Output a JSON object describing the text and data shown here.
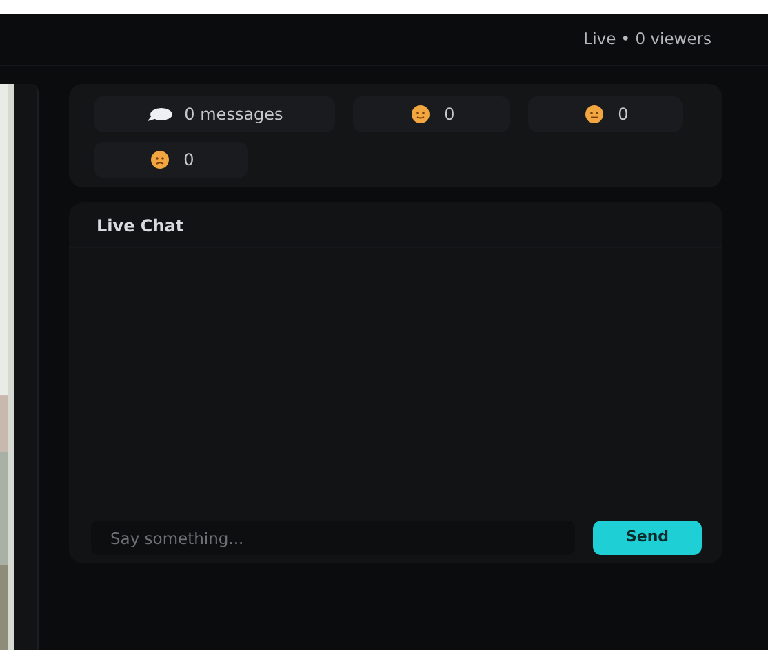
{
  "header": {
    "status": "Live • 0 viewers"
  },
  "stats": [
    {
      "kind": "chat",
      "text": "0 messages"
    },
    {
      "kind": "smile",
      "text": "0"
    },
    {
      "kind": "neutral",
      "text": "0"
    },
    {
      "kind": "sad",
      "text": "0"
    }
  ],
  "chat": {
    "title": "Live Chat",
    "input": {
      "placeholder": "Say something..."
    },
    "send": "Send"
  }
}
